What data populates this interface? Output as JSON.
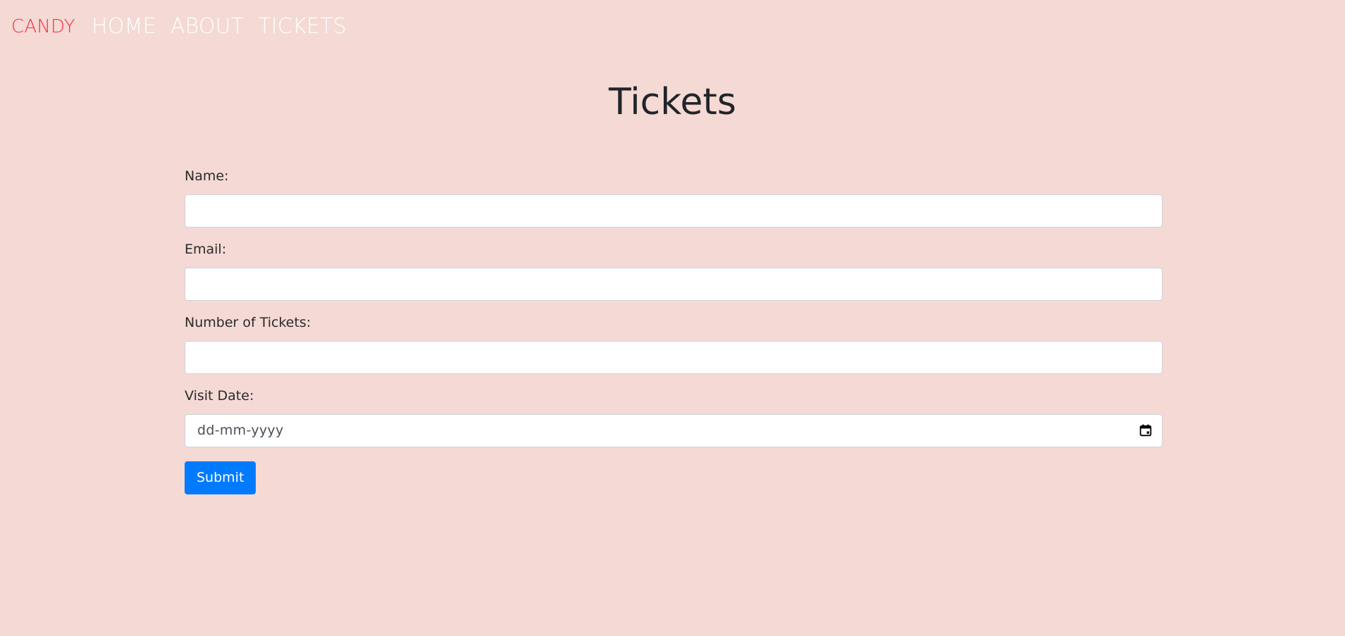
{
  "nav": {
    "brand": "CANDY",
    "links": [
      "HOME",
      "ABOUT",
      "TICKETS"
    ]
  },
  "page": {
    "title": "Tickets"
  },
  "form": {
    "fields": [
      {
        "label": "Name:",
        "value": ""
      },
      {
        "label": "Email:",
        "value": ""
      },
      {
        "label": "Number of Tickets:",
        "value": ""
      },
      {
        "label": "Visit Date:",
        "placeholder": "dd-mm-yyyy"
      }
    ],
    "submit_label": "Submit"
  },
  "colors": {
    "background": "#f4d9d5",
    "brand": "#f8303f",
    "nav_link": "#ffffff",
    "primary_button": "#007bff"
  },
  "icons": {
    "date_picker": "calendar-icon"
  }
}
